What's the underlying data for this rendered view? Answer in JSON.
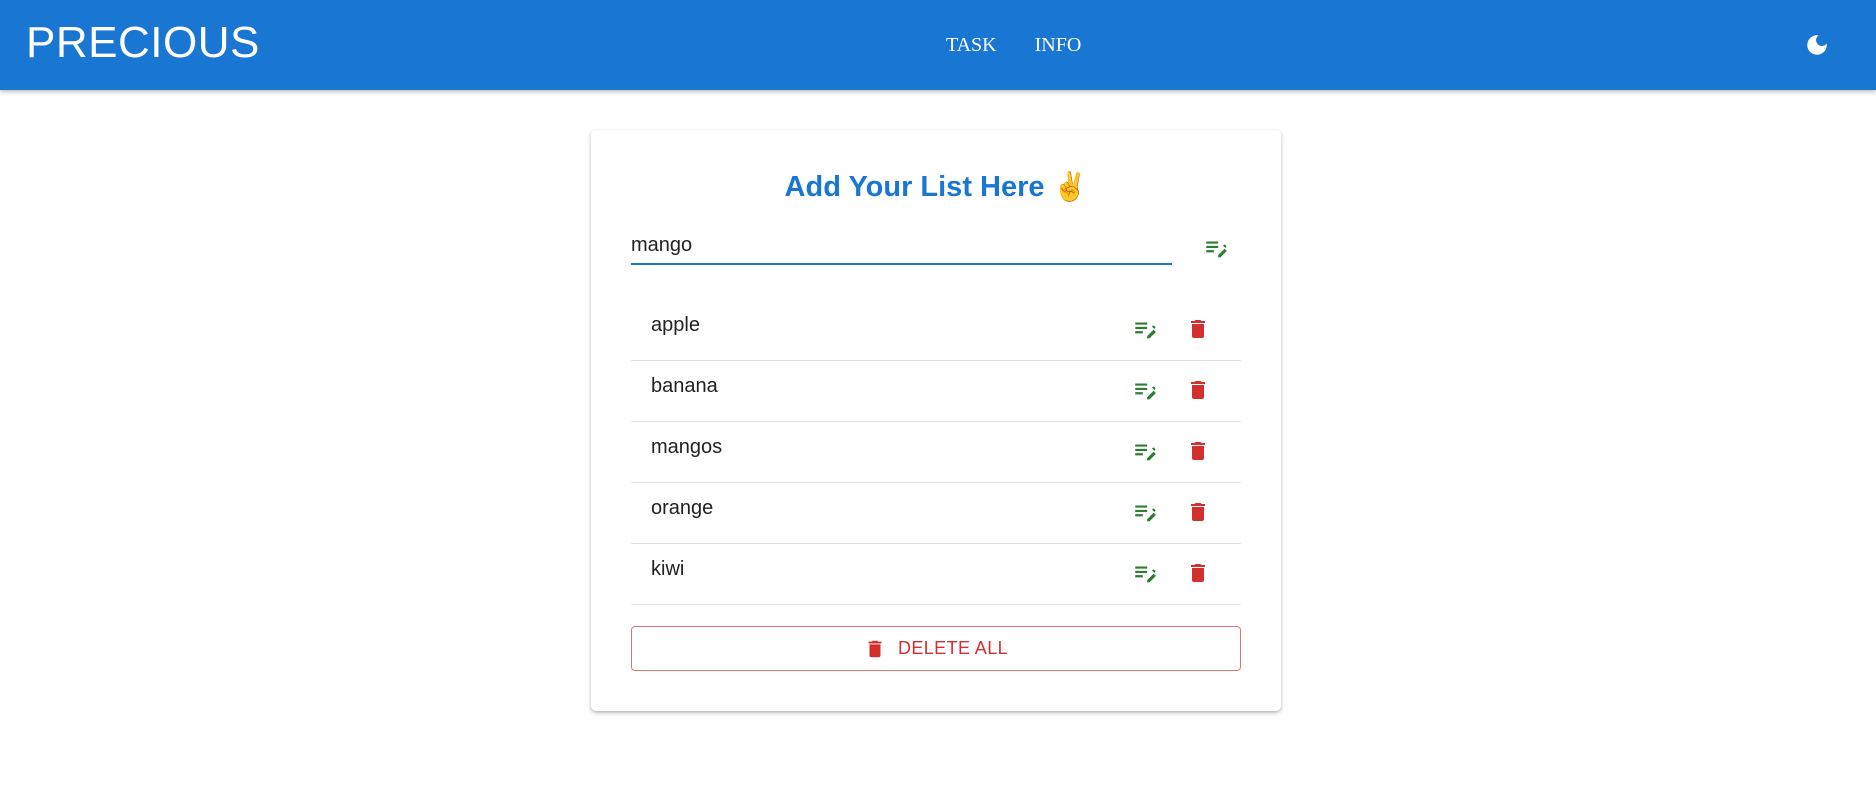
{
  "appbar": {
    "brand": "PRECIOUS",
    "nav": [
      "TASK",
      "INFO"
    ],
    "theme_icon": "moon-icon"
  },
  "colors": {
    "primary": "#1976d2",
    "edit": "#2e7d32",
    "danger": "#d32f2f"
  },
  "card": {
    "title": "Add Your List Here",
    "title_emoji": "✌️",
    "input_value": "mango",
    "add_icon": "playlist-edit-icon",
    "items": [
      {
        "label": "apple"
      },
      {
        "label": "banana"
      },
      {
        "label": "mangos"
      },
      {
        "label": "orange"
      },
      {
        "label": "kiwi"
      }
    ],
    "edit_icon": "playlist-edit-icon",
    "delete_icon": "trash-icon",
    "delete_all_label": "DELETE ALL"
  }
}
